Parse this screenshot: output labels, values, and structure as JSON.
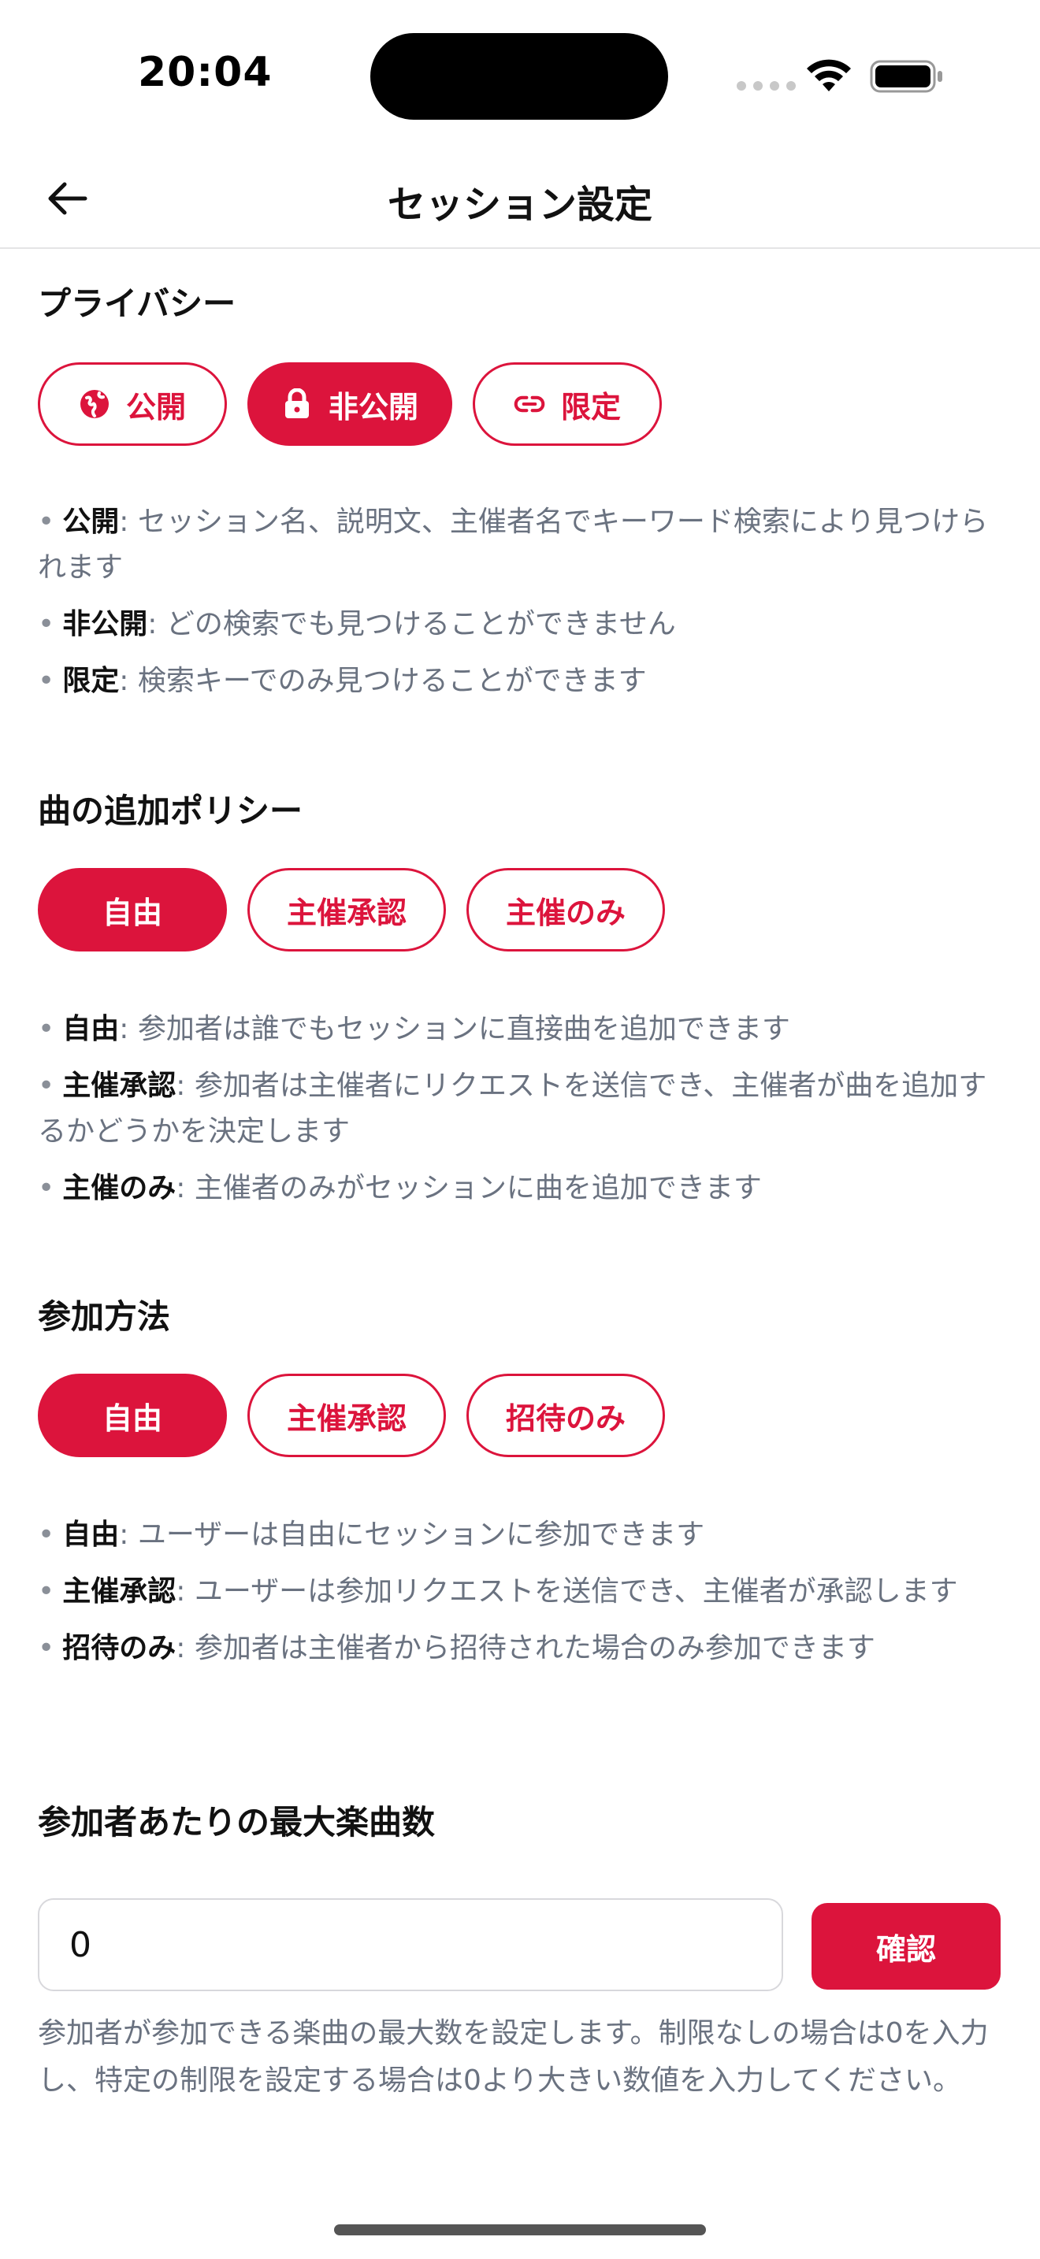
{
  "status_bar": {
    "time": "20:04",
    "icons": [
      "signal-dots-icon",
      "wifi-icon",
      "battery-icon"
    ]
  },
  "nav": {
    "back_icon": "arrow-left-icon",
    "title": "セッション設定"
  },
  "colors": {
    "accent": "#dc143c",
    "text_primary": "#111111",
    "text_secondary": "#6a7280",
    "border": "#d8d8dc"
  },
  "privacy": {
    "title": "プライバシー",
    "options": [
      {
        "label": "公開",
        "icon": "globe-icon",
        "selected": false
      },
      {
        "label": "非公開",
        "icon": "lock-icon",
        "selected": true
      },
      {
        "label": "限定",
        "icon": "link-icon",
        "selected": false
      }
    ],
    "descriptions": [
      {
        "term": "公開",
        "text": ": セッション名、説明文、主催者名でキーワード検索により見つけられます"
      },
      {
        "term": "非公開",
        "text": ": どの検索でも見つけることができません"
      },
      {
        "term": "限定",
        "text": ": 検索キーでのみ見つけることができます"
      }
    ]
  },
  "song_policy": {
    "title": "曲の追加ポリシー",
    "options": [
      {
        "label": "自由",
        "selected": true
      },
      {
        "label": "主催承認",
        "selected": false
      },
      {
        "label": "主催のみ",
        "selected": false
      }
    ],
    "descriptions": [
      {
        "term": "自由",
        "text": ": 参加者は誰でもセッションに直接曲を追加できます"
      },
      {
        "term": "主催承認",
        "text": ": 参加者は主催者にリクエストを送信でき、主催者が曲を追加するかどうかを決定します"
      },
      {
        "term": "主催のみ",
        "text": ": 主催者のみがセッションに曲を追加できます"
      }
    ]
  },
  "join_method": {
    "title": "参加方法",
    "options": [
      {
        "label": "自由",
        "selected": true
      },
      {
        "label": "主催承認",
        "selected": false
      },
      {
        "label": "招待のみ",
        "selected": false
      }
    ],
    "descriptions": [
      {
        "term": "自由",
        "text": ": ユーザーは自由にセッションに参加できます"
      },
      {
        "term": "主催承認",
        "text": ": ユーザーは参加リクエストを送信でき、主催者が承認します"
      },
      {
        "term": "招待のみ",
        "text": ": 参加者は主催者から招待された場合のみ参加できます"
      }
    ]
  },
  "max_songs": {
    "title": "参加者あたりの最大楽曲数",
    "value": "0",
    "confirm_label": "確認",
    "help": "参加者が参加できる楽曲の最大数を設定します。制限なしの場合は0を入力し、特定の制限を設定する場合は0より大きい数値を入力してください。"
  }
}
